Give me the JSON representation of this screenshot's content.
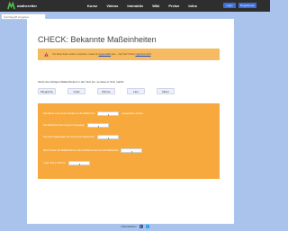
{
  "header": {
    "logo_text": "matheretter",
    "nav": [
      "Kurse",
      "Videos",
      "Interaktiv",
      "Wiki",
      "Preise",
      "Infos"
    ],
    "login_label": "Login",
    "register_label": "Registrieren"
  },
  "search": {
    "placeholder": "Suchbegriff eingeben"
  },
  "main": {
    "title": "CHECK: Bekannte Maßeinheiten",
    "warning": {
      "text_before": "Um diese Seite nutzen zu können, musst du",
      "link1": "angemeldet",
      "text_middle": "sein. - Neu hier? Dann",
      "link2": "registriere dich",
      "text_after": "!"
    },
    "instruction": "Setze die richtigen Maßeinheiten in den Text ein, so dass er Sinn macht:",
    "chips": [
      "Kilogramm",
      "Grad",
      "Minute",
      "Liter",
      "Meter"
    ],
    "exercise": [
      {
        "before": "Die Masse eines Autos beträgt um die Maßeinheit",
        "after": "ausgegeben werden."
      },
      {
        "before": "Die Maßeinheit der Länge ist festgelegt:",
        "after": ""
      },
      {
        "before": "Die kurze Maßangabe der Zeit gilt die Maßeinheit",
        "after": ""
      },
      {
        "before": "Wenn \"Kuss\" die Maßeinheit ist, dann handelt es sich um die Maßeinheit",
        "after": ""
      },
      {
        "before": "\"Liga\" wird in Maß für",
        "after": ""
      }
    ]
  },
  "footer": {
    "text": "Unterstützen"
  },
  "colors": {
    "page_bg": "#a9c3ec",
    "topbar": "#2e2e2e",
    "warning_bg": "#f6bb60",
    "exercise_bg": "#f7a93d",
    "accent_button": "#3a6fd8"
  }
}
